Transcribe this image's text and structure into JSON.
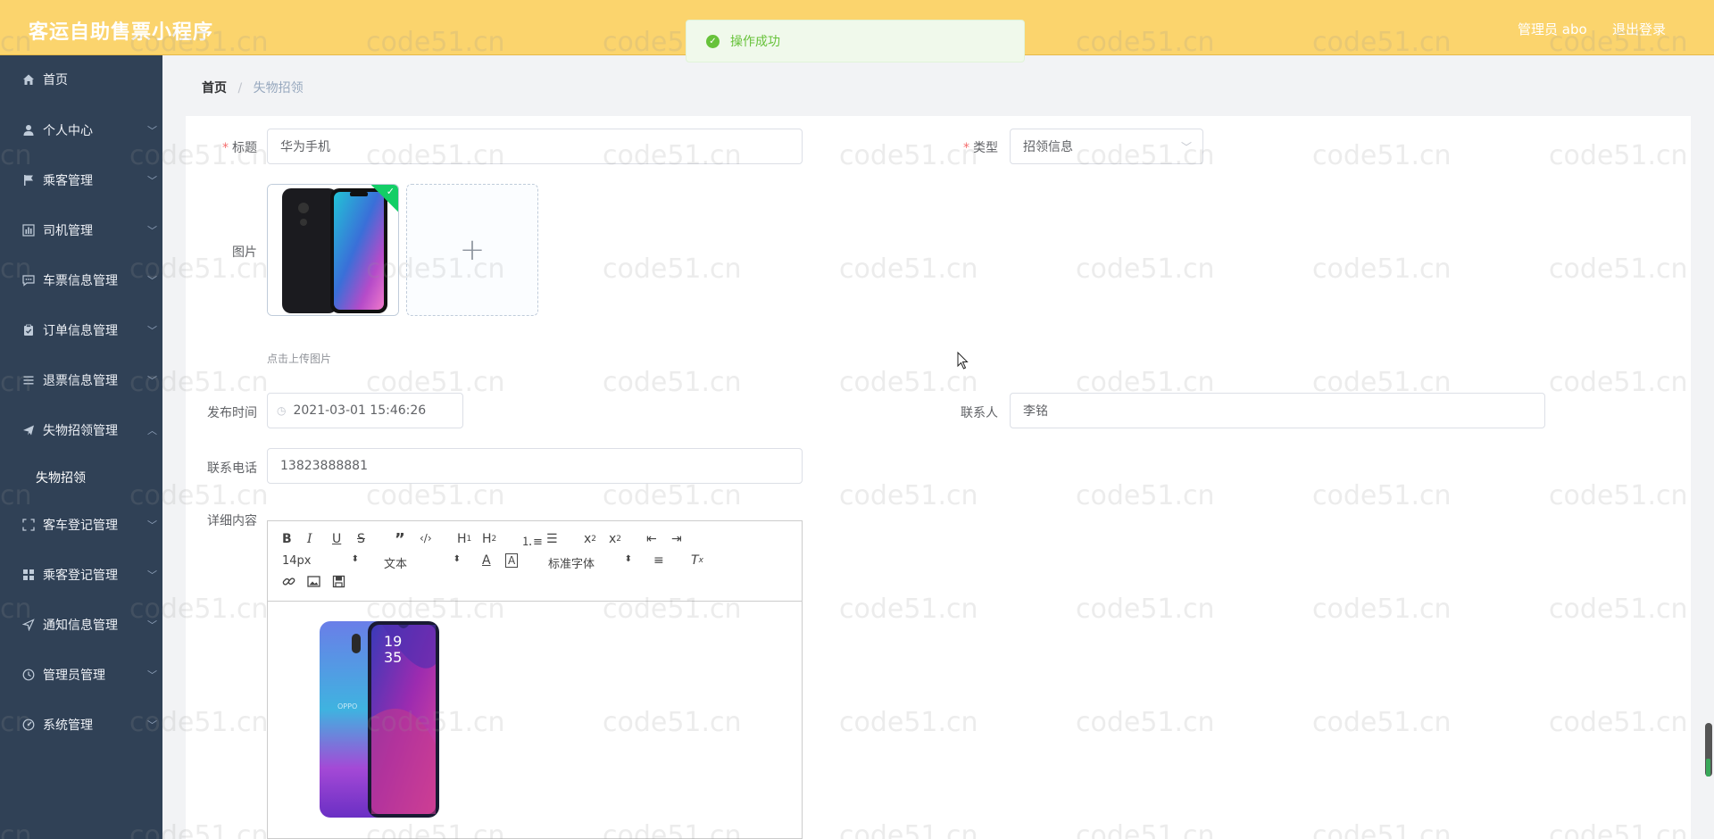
{
  "header": {
    "app_title": "客运自助售票小程序",
    "admin_label": "管理员 abo",
    "logout_label": "退出登录"
  },
  "toast": {
    "message": "操作成功"
  },
  "sidebar": {
    "items": [
      {
        "label": "首页",
        "icon": "home-icon"
      },
      {
        "label": "个人中心",
        "icon": "user-icon"
      },
      {
        "label": "乘客管理",
        "icon": "flag-icon"
      },
      {
        "label": "司机管理",
        "icon": "chart-icon"
      },
      {
        "label": "车票信息管理",
        "icon": "chat-icon"
      },
      {
        "label": "订单信息管理",
        "icon": "clipboard-icon"
      },
      {
        "label": "退票信息管理",
        "icon": "list-icon"
      },
      {
        "label": "失物招领管理",
        "icon": "send-icon"
      },
      {
        "label": "客车登记管理",
        "icon": "fullscreen-icon"
      },
      {
        "label": "乘客登记管理",
        "icon": "grid-icon"
      },
      {
        "label": "通知信息管理",
        "icon": "navigation-icon"
      },
      {
        "label": "管理员管理",
        "icon": "clock-icon"
      },
      {
        "label": "系统管理",
        "icon": "dashboard-icon"
      }
    ],
    "active_sub": "失物招领"
  },
  "breadcrumb": {
    "home": "首页",
    "sep": "/",
    "current": "失物招领"
  },
  "form": {
    "title_label": "标题",
    "title_value": "华为手机",
    "type_label": "类型",
    "type_value": "招领信息",
    "image_label": "图片",
    "upload_tip": "点击上传图片",
    "publish_time_label": "发布时间",
    "publish_time_value": "2021-03-01 15:46:26",
    "contact_label": "联系人",
    "contact_value": "李铭",
    "phone_label": "联系电话",
    "phone_value": "13823888881",
    "detail_label": "详细内容"
  },
  "editor": {
    "font_size": "14px",
    "header_select": "文本",
    "font_family": "标准字体"
  },
  "watermark": "code51.cn",
  "colors": {
    "header_bg": "#fbd46d",
    "sidebar_bg": "#304156",
    "success": "#67c23a",
    "required": "#f56c6c"
  }
}
